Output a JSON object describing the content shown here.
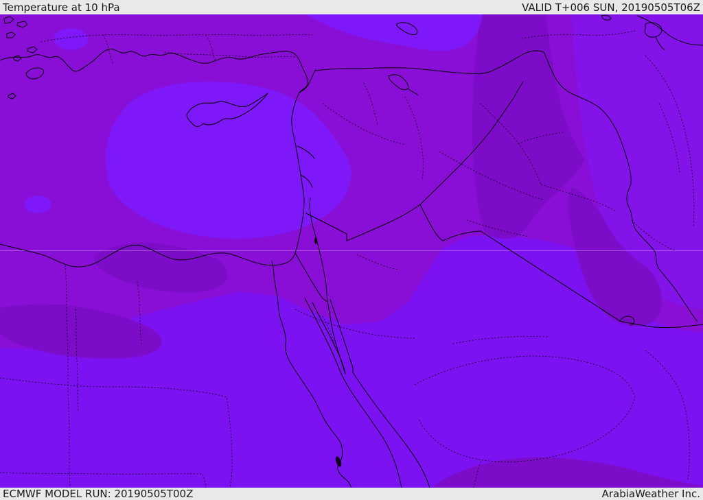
{
  "header": {
    "title": "Temperature at 10 hPa",
    "valid": "VALID T+006 SUN, 20190505T06Z"
  },
  "footer": {
    "model_run": "ECMWF MODEL RUN: 20190505T00Z",
    "credit": "ArabiaWeather Inc."
  },
  "map": {
    "kind": "filled temperature contour map, Middle East region",
    "colors": {
      "band_medium": "#8a0fd6",
      "band_bright": "#7c12f2",
      "band_brighter": "#7e18f8",
      "band_dark": "#7d0cc8",
      "band_intermediate": "#8413e9",
      "border_line": "#000000",
      "panel_bg": "#e9e9e9",
      "panel_text": "#1b1b1b"
    }
  }
}
